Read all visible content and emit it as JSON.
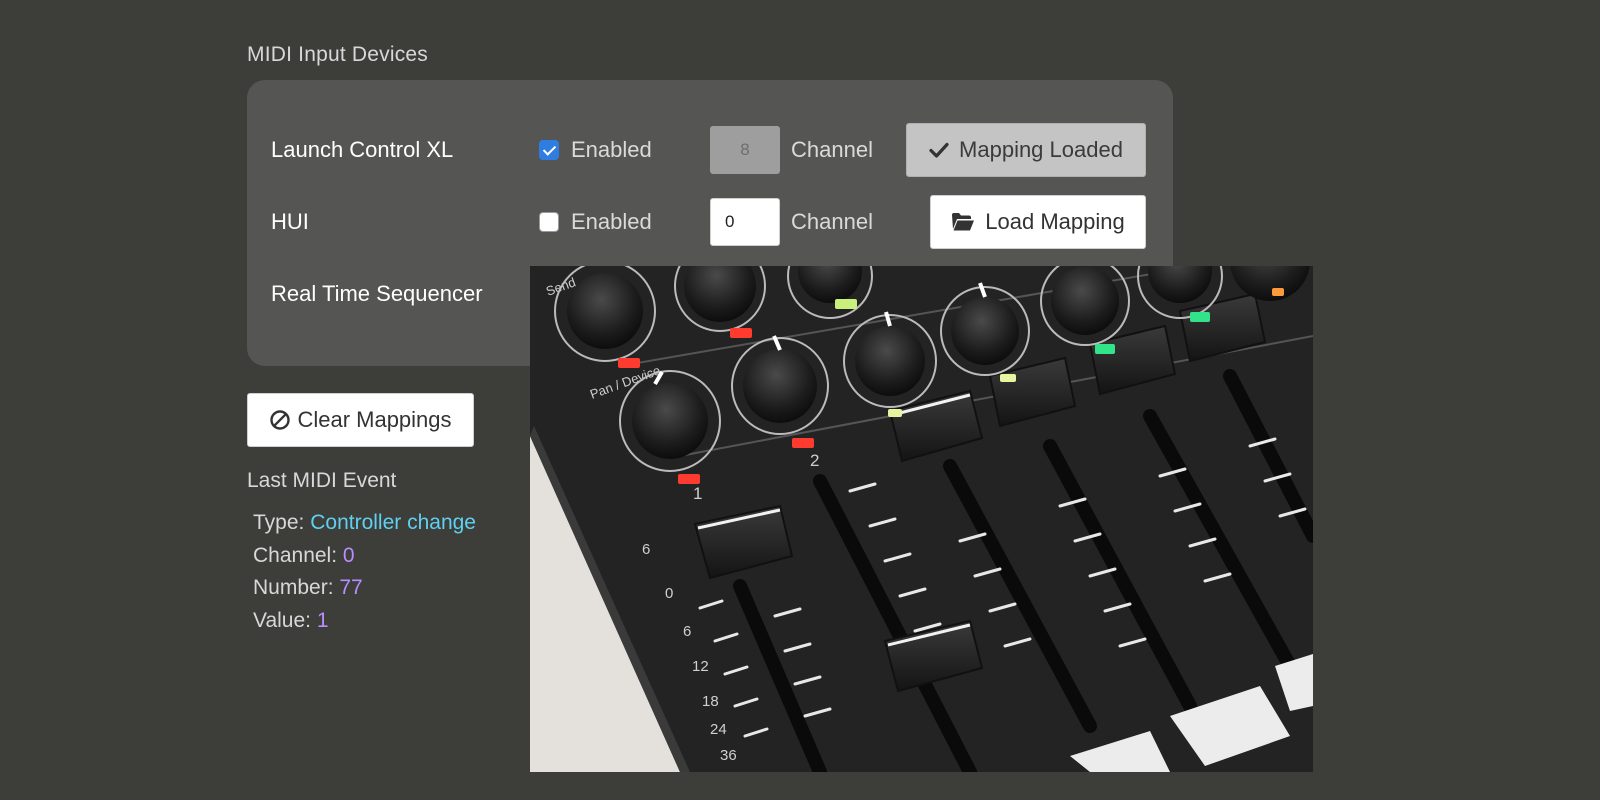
{
  "section_title": "MIDI Input Devices",
  "colors": {
    "background": "#3d3d3a",
    "panel": "#555553",
    "checkbox_blue": "#2f7de1",
    "value_cyan": "#5fd1f0",
    "value_purple": "#b98cff"
  },
  "devices": [
    {
      "name": "Launch Control XL",
      "enabled": true,
      "enabled_label": "Enabled",
      "channel": "8",
      "channel_disabled": true,
      "channel_label": "Channel",
      "button_label": "Mapping Loaded",
      "button_icon": "check-icon"
    },
    {
      "name": "HUI",
      "enabled": false,
      "enabled_label": "Enabled",
      "channel": "0",
      "channel_disabled": false,
      "channel_label": "Channel",
      "button_label": "Load Mapping",
      "button_icon": "folder-open-icon"
    },
    {
      "name": "Real Time Sequencer"
    }
  ],
  "clear_button": {
    "label": "Clear Mappings",
    "icon": "ban-icon"
  },
  "last_event": {
    "title": "Last MIDI Event",
    "type_label": "Type:",
    "type_value": "Controller change",
    "channel_label": "Channel:",
    "channel_value": "0",
    "number_label": "Number:",
    "number_value": "77",
    "value_label": "Value:",
    "value_value": "1"
  },
  "photo": {
    "subject": "midi-controller-photo",
    "fader_scale": [
      "6",
      "0",
      "6",
      "12",
      "18",
      "24",
      "36"
    ],
    "channel_numbers": [
      "1",
      "2"
    ],
    "knob_labels": [
      "Send",
      "Pan / Device"
    ]
  }
}
